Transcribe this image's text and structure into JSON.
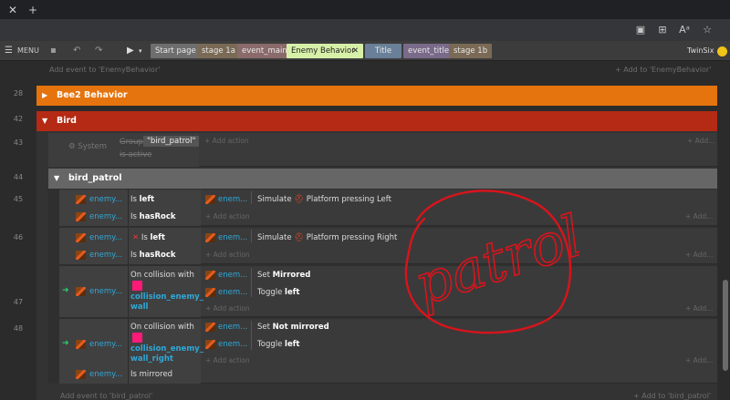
{
  "browser": {
    "new_tab": "+"
  },
  "toolbar": {
    "menu_label": "MENU",
    "user_name": "TwinSix"
  },
  "tabs": [
    {
      "label": "Start page"
    },
    {
      "label": "stage 1a"
    },
    {
      "label": "event_main"
    },
    {
      "label": "Enemy Behavior"
    },
    {
      "label": "Title"
    },
    {
      "label": "event_title"
    },
    {
      "label": "stage 1b"
    }
  ],
  "hints": {
    "add_event_top": "Add event to 'EnemyBehavior'",
    "add_to_top": "+ Add to 'EnemyBehavior'",
    "add_event_bottom": "Add event to 'bird_patrol'",
    "add_to_bottom": "+ Add to 'bird_patrol'"
  },
  "groups": {
    "bee2": {
      "line": "28",
      "title": "Bee2 Behavior",
      "color": "#e5740e"
    },
    "bird": {
      "line": "42",
      "title": "Bird",
      "color": "#b52a14"
    },
    "bird_patrol": {
      "line": "44",
      "title": "bird_patrol"
    }
  },
  "system_event": {
    "line": "43",
    "object": "System",
    "condition_prefix": "Group",
    "group_name": "\"bird_patrol\"",
    "condition_suffix": "is active",
    "add_action": "+ Add action",
    "add_right": "+ Add..."
  },
  "events": {
    "e45": {
      "line": "45",
      "cond1_obj": "enemy...",
      "cond1_text": "Is",
      "cond1_bold": "left",
      "cond2_obj": "enemy...",
      "cond2_text": "Is",
      "cond2_bold": "hasRock",
      "act_obj": "enem...",
      "act_text": "Simulate",
      "act_rest": "Platform pressing Left",
      "add_action": "+ Add action",
      "add_right": "+ Add..."
    },
    "e46": {
      "line": "46",
      "cond1_obj": "enemy...",
      "cond1_invert": "✕",
      "cond1_text": "Is",
      "cond1_bold": "left",
      "cond2_obj": "enemy...",
      "cond2_text": "Is",
      "cond2_bold": "hasRock",
      "act_obj": "enem...",
      "act_text": "Simulate",
      "act_rest": "Platform pressing Right",
      "add_action": "+ Add action",
      "add_right": "+ Add..."
    },
    "e47": {
      "line": "47",
      "cond_obj": "enemy...",
      "cond_text": "On collision with",
      "cond_target": "collision_enemy_ wall",
      "act1_obj": "enem...",
      "act1_text": "Set",
      "act1_bold": "Mirrored",
      "act2_obj": "enem...",
      "act2_text": "Toggle",
      "act2_bold": "left",
      "add_action": "+ Add action",
      "add_right": "+ Add..."
    },
    "e48": {
      "line": "48",
      "cond_obj": "enemy...",
      "cond_text": "On collision with",
      "cond_target": "collision_enemy_ wall_right",
      "cond2_obj": "enemy...",
      "cond2_text": "Is mirrored",
      "act1_obj": "enem...",
      "act1_text": "Set",
      "act1_bold": "Not mirrored",
      "act2_obj": "enem...",
      "act2_text": "Toggle",
      "act2_bold": "left",
      "add_action": "+ Add action",
      "add_right": "+ Add..."
    }
  },
  "annotation": {
    "text": "patrol",
    "color": "#d8141c"
  }
}
